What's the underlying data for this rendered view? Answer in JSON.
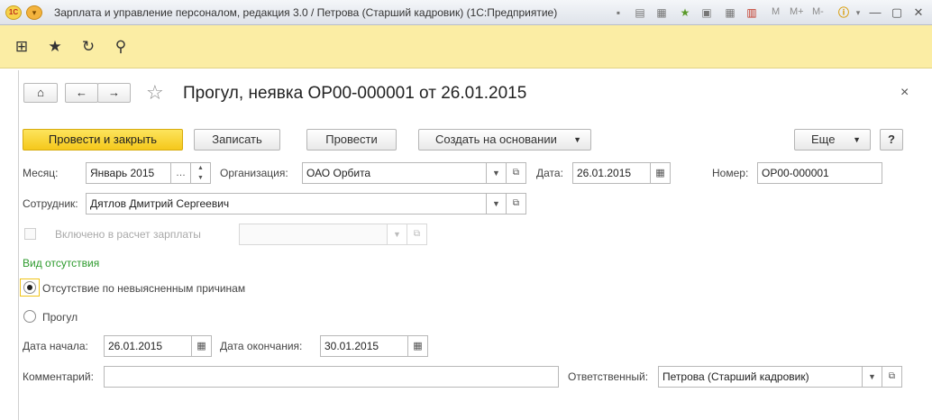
{
  "window": {
    "title": "Зарплата и управление персоналом, редакция 3.0 / Петрова (Старший кадровик)  (1С:Предприятие)",
    "logo": "1C",
    "m_labels": [
      "M",
      "M+",
      "M-"
    ]
  },
  "nav": {
    "home": "⌂",
    "back": "←",
    "forward": "→",
    "star": "☆",
    "close": "×"
  },
  "form": {
    "title": "Прогул, неявка ОР00-000001 от 26.01.2015"
  },
  "toolbar": {
    "post_close": "Провести и закрыть",
    "save": "Записать",
    "post": "Провести",
    "create_basis": "Создать на основании",
    "more": "Еще",
    "help": "?"
  },
  "fields": {
    "month_label": "Месяц:",
    "month_value": "Январь 2015",
    "org_label": "Организация:",
    "org_value": "ОАО Орбита",
    "date_label": "Дата:",
    "date_value": "26.01.2015",
    "number_label": "Номер:",
    "number_value": "ОР00-000001",
    "employee_label": "Сотрудник:",
    "employee_value": "Дятлов Дмитрий Сергеевич",
    "payroll_label": "Включено в расчет зарплаты",
    "absence_section": "Вид отсутствия",
    "radio_unexplained": "Отсутствие по невыясненным причинам",
    "radio_truancy": "Прогул",
    "start_label": "Дата начала:",
    "start_value": "26.01.2015",
    "end_label": "Дата окончания:",
    "end_value": "30.01.2015",
    "comment_label": "Комментарий:",
    "comment_value": "",
    "responsible_label": "Ответственный:",
    "responsible_value": "Петрова (Старший кадровик)"
  },
  "colors": {
    "accent_yellow": "#fbeda4",
    "primary_button": "#f5c81b",
    "section_green": "#2c9a2c"
  }
}
